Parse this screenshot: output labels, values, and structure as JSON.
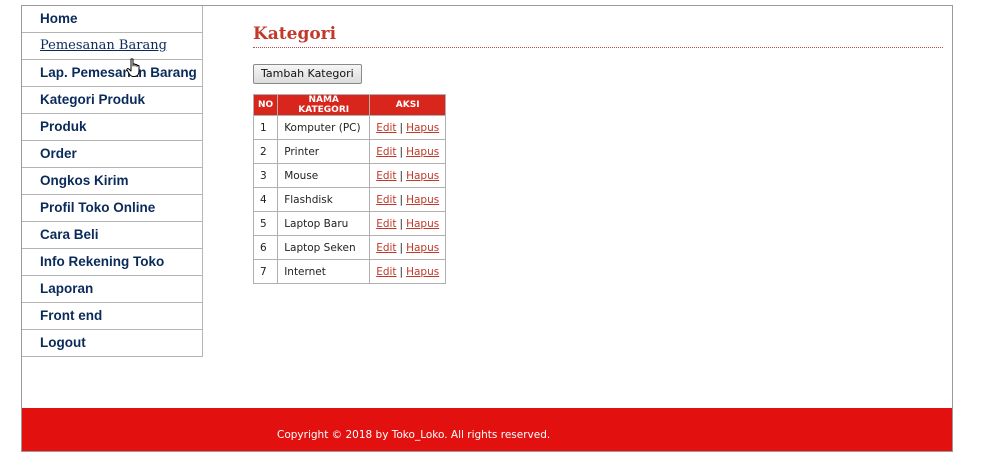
{
  "sidebar": {
    "items": [
      {
        "label": "Home"
      },
      {
        "label": "Pemesanan Barang"
      },
      {
        "label": "Lap. Pemesanan Barang"
      },
      {
        "label": "Kategori Produk"
      },
      {
        "label": "Produk"
      },
      {
        "label": "Order"
      },
      {
        "label": "Ongkos Kirim"
      },
      {
        "label": "Profil Toko Online"
      },
      {
        "label": "Cara Beli"
      },
      {
        "label": "Info Rekening Toko"
      },
      {
        "label": "Laporan"
      },
      {
        "label": "Front end"
      },
      {
        "label": "Logout"
      }
    ]
  },
  "main": {
    "title": "Kategori",
    "add_button": "Tambah Kategori",
    "table": {
      "headers": [
        "NO",
        "NAMA KATEGORI",
        "AKSI"
      ],
      "rows": [
        {
          "no": "1",
          "nama": "Komputer (PC)",
          "edit": "Edit",
          "sep": "|",
          "hapus": "Hapus"
        },
        {
          "no": "2",
          "nama": "Printer",
          "edit": "Edit",
          "sep": "|",
          "hapus": "Hapus"
        },
        {
          "no": "3",
          "nama": "Mouse",
          "edit": "Edit",
          "sep": "|",
          "hapus": "Hapus"
        },
        {
          "no": "4",
          "nama": "Flashdisk",
          "edit": "Edit",
          "sep": "|",
          "hapus": "Hapus"
        },
        {
          "no": "5",
          "nama": "Laptop Baru",
          "edit": "Edit",
          "sep": "|",
          "hapus": "Hapus"
        },
        {
          "no": "6",
          "nama": "Laptop Seken",
          "edit": "Edit",
          "sep": "|",
          "hapus": "Hapus"
        },
        {
          "no": "7",
          "nama": "Internet",
          "edit": "Edit",
          "sep": "|",
          "hapus": "Hapus"
        }
      ]
    }
  },
  "footer": {
    "copyright": "Copyright © 2018 by Toko_Loko. All rights reserved."
  },
  "colors": {
    "accent_red": "#e31010",
    "title_red": "#c0392b",
    "nav_text": "#0a2a5a"
  },
  "icons": {
    "cursor": "hand-pointer-icon"
  }
}
